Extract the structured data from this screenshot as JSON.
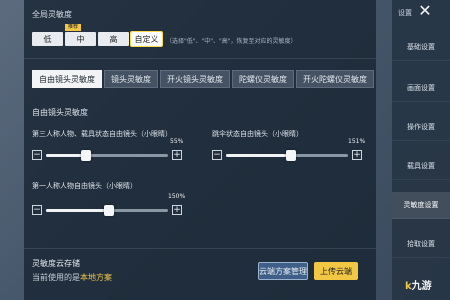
{
  "global": {
    "title": "全局灵敏度",
    "options": [
      "低",
      "中",
      "高",
      "自定义"
    ],
    "selected_index": 3,
    "badge": "推荐",
    "hint": "（选择\"低\"、\"中\"、\"高\"，恢复至对应的灵敏度）"
  },
  "tabs": [
    "自由镜头灵敏度",
    "镜头灵敏度",
    "开火镜头灵敏度",
    "陀螺仪灵敏度",
    "开火陀螺仪灵敏度"
  ],
  "active_tab": 0,
  "section": {
    "title": "自由镜头灵敏度"
  },
  "sliders": [
    {
      "label": "第三人称人物、载具状态自由镜头（小眼睛）",
      "value_label": "55%",
      "value": 0.33
    },
    {
      "label": "跳伞状态自由镜头（小眼睛）",
      "value_label": "151%",
      "value": 0.53
    },
    {
      "label": "第一人称人物自由镜头（小眼睛）",
      "value_label": "150%",
      "value": 0.52
    }
  ],
  "storage": {
    "title": "灵敏度云存储",
    "current_prefix": "当前使用的是",
    "current_value": "本地方案",
    "manage_button": "云端方案管理",
    "upload_button": "上传云端"
  },
  "sidebar": {
    "top_label": "设置",
    "items": [
      "基础设置",
      "画面设置",
      "操作设置",
      "载具设置",
      "灵敏度设置",
      "拾取设置"
    ],
    "active_index": 4
  },
  "watermark": {
    "prefix": "k",
    "text": "九游"
  },
  "colors": {
    "accent": "#f2c744",
    "panel": "#182432"
  }
}
